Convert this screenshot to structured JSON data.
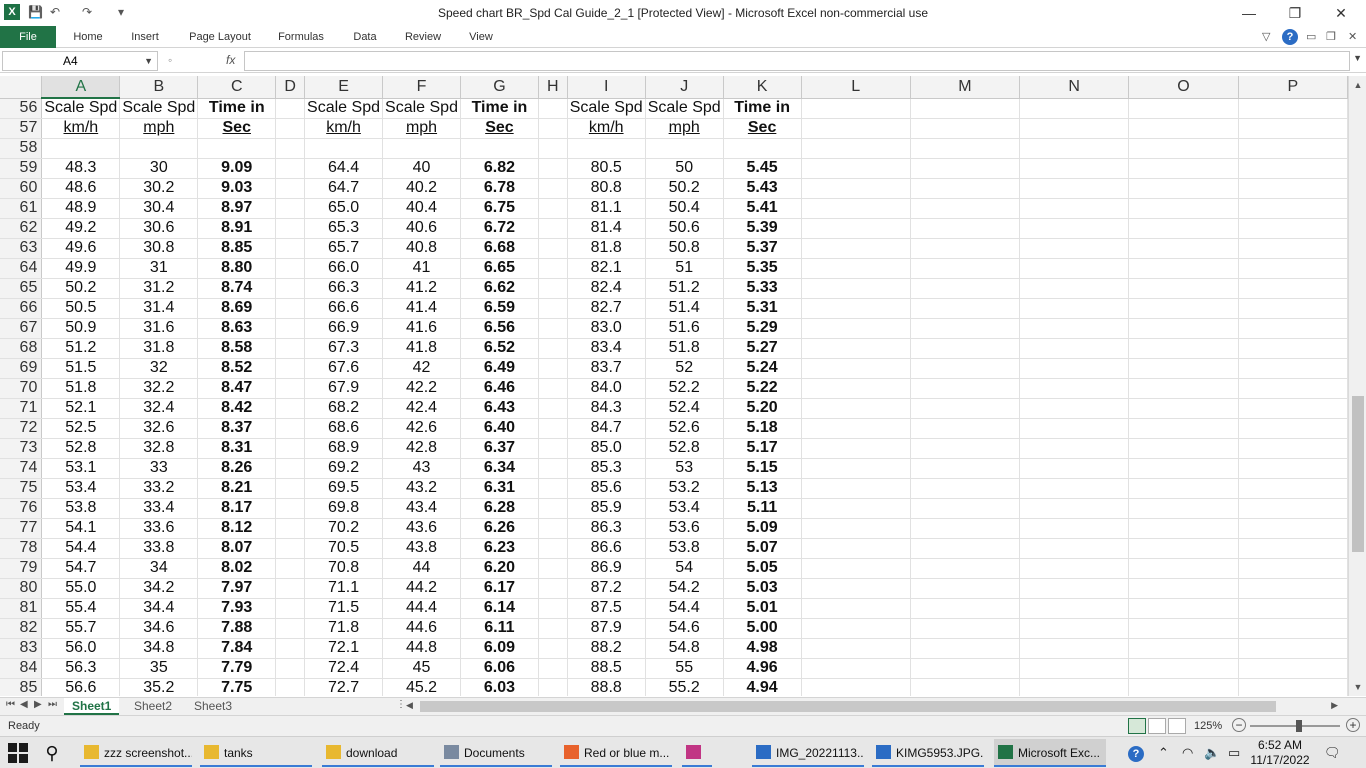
{
  "window": {
    "title": "Speed chart BR_Spd Cal Guide_2_1  [Protected View]  -  Microsoft Excel non-commercial use",
    "app_icon": "X",
    "minimize": "—",
    "restore": "❐",
    "close": "✕"
  },
  "qat": {
    "save": "💾",
    "undo": "↶",
    "redo": "↷",
    "more": "▾"
  },
  "ribbon": {
    "tabs": [
      "File",
      "Home",
      "Insert",
      "Page Layout",
      "Formulas",
      "Data",
      "Review",
      "View"
    ],
    "collapse": "▽",
    "help": "?"
  },
  "formula_bar": {
    "name_box": "A4",
    "fx": "fx",
    "formula": ""
  },
  "columns": [
    "A",
    "B",
    "C",
    "D",
    "E",
    "F",
    "G",
    "H",
    "I",
    "J",
    "K",
    "L",
    "M",
    "N",
    "O",
    "P"
  ],
  "header_rows": [
    {
      "row": "56",
      "cells": [
        "Scale Spd",
        "Scale Spd",
        "Time in",
        "",
        "Scale Spd",
        "Scale Spd",
        "Time in",
        "",
        "Scale Spd",
        "Scale Spd",
        "Time in"
      ]
    },
    {
      "row": "57",
      "cells": [
        "km/h",
        "mph",
        "Sec",
        "",
        "km/h",
        "mph",
        "Sec",
        "",
        "km/h",
        "mph",
        "Sec"
      ]
    },
    {
      "row": "58",
      "cells": [
        "",
        "",
        "",
        "",
        "",
        "",
        "",
        "",
        "",
        "",
        ""
      ]
    }
  ],
  "data_rows": [
    {
      "row": "59",
      "cells": [
        "48.3",
        "30",
        "9.09",
        "",
        "64.4",
        "40",
        "6.82",
        "",
        "80.5",
        "50",
        "5.45"
      ]
    },
    {
      "row": "60",
      "cells": [
        "48.6",
        "30.2",
        "9.03",
        "",
        "64.7",
        "40.2",
        "6.78",
        "",
        "80.8",
        "50.2",
        "5.43"
      ]
    },
    {
      "row": "61",
      "cells": [
        "48.9",
        "30.4",
        "8.97",
        "",
        "65.0",
        "40.4",
        "6.75",
        "",
        "81.1",
        "50.4",
        "5.41"
      ]
    },
    {
      "row": "62",
      "cells": [
        "49.2",
        "30.6",
        "8.91",
        "",
        "65.3",
        "40.6",
        "6.72",
        "",
        "81.4",
        "50.6",
        "5.39"
      ]
    },
    {
      "row": "63",
      "cells": [
        "49.6",
        "30.8",
        "8.85",
        "",
        "65.7",
        "40.8",
        "6.68",
        "",
        "81.8",
        "50.8",
        "5.37"
      ]
    },
    {
      "row": "64",
      "cells": [
        "49.9",
        "31",
        "8.80",
        "",
        "66.0",
        "41",
        "6.65",
        "",
        "82.1",
        "51",
        "5.35"
      ]
    },
    {
      "row": "65",
      "cells": [
        "50.2",
        "31.2",
        "8.74",
        "",
        "66.3",
        "41.2",
        "6.62",
        "",
        "82.4",
        "51.2",
        "5.33"
      ]
    },
    {
      "row": "66",
      "cells": [
        "50.5",
        "31.4",
        "8.69",
        "",
        "66.6",
        "41.4",
        "6.59",
        "",
        "82.7",
        "51.4",
        "5.31"
      ]
    },
    {
      "row": "67",
      "cells": [
        "50.9",
        "31.6",
        "8.63",
        "",
        "66.9",
        "41.6",
        "6.56",
        "",
        "83.0",
        "51.6",
        "5.29"
      ]
    },
    {
      "row": "68",
      "cells": [
        "51.2",
        "31.8",
        "8.58",
        "",
        "67.3",
        "41.8",
        "6.52",
        "",
        "83.4",
        "51.8",
        "5.27"
      ]
    },
    {
      "row": "69",
      "cells": [
        "51.5",
        "32",
        "8.52",
        "",
        "67.6",
        "42",
        "6.49",
        "",
        "83.7",
        "52",
        "5.24"
      ]
    },
    {
      "row": "70",
      "cells": [
        "51.8",
        "32.2",
        "8.47",
        "",
        "67.9",
        "42.2",
        "6.46",
        "",
        "84.0",
        "52.2",
        "5.22"
      ]
    },
    {
      "row": "71",
      "cells": [
        "52.1",
        "32.4",
        "8.42",
        "",
        "68.2",
        "42.4",
        "6.43",
        "",
        "84.3",
        "52.4",
        "5.20"
      ]
    },
    {
      "row": "72",
      "cells": [
        "52.5",
        "32.6",
        "8.37",
        "",
        "68.6",
        "42.6",
        "6.40",
        "",
        "84.7",
        "52.6",
        "5.18"
      ]
    },
    {
      "row": "73",
      "cells": [
        "52.8",
        "32.8",
        "8.31",
        "",
        "68.9",
        "42.8",
        "6.37",
        "",
        "85.0",
        "52.8",
        "5.17"
      ]
    },
    {
      "row": "74",
      "cells": [
        "53.1",
        "33",
        "8.26",
        "",
        "69.2",
        "43",
        "6.34",
        "",
        "85.3",
        "53",
        "5.15"
      ]
    },
    {
      "row": "75",
      "cells": [
        "53.4",
        "33.2",
        "8.21",
        "",
        "69.5",
        "43.2",
        "6.31",
        "",
        "85.6",
        "53.2",
        "5.13"
      ]
    },
    {
      "row": "76",
      "cells": [
        "53.8",
        "33.4",
        "8.17",
        "",
        "69.8",
        "43.4",
        "6.28",
        "",
        "85.9",
        "53.4",
        "5.11"
      ]
    },
    {
      "row": "77",
      "cells": [
        "54.1",
        "33.6",
        "8.12",
        "",
        "70.2",
        "43.6",
        "6.26",
        "",
        "86.3",
        "53.6",
        "5.09"
      ]
    },
    {
      "row": "78",
      "cells": [
        "54.4",
        "33.8",
        "8.07",
        "",
        "70.5",
        "43.8",
        "6.23",
        "",
        "86.6",
        "53.8",
        "5.07"
      ]
    },
    {
      "row": "79",
      "cells": [
        "54.7",
        "34",
        "8.02",
        "",
        "70.8",
        "44",
        "6.20",
        "",
        "86.9",
        "54",
        "5.05"
      ]
    },
    {
      "row": "80",
      "cells": [
        "55.0",
        "34.2",
        "7.97",
        "",
        "71.1",
        "44.2",
        "6.17",
        "",
        "87.2",
        "54.2",
        "5.03"
      ]
    },
    {
      "row": "81",
      "cells": [
        "55.4",
        "34.4",
        "7.93",
        "",
        "71.5",
        "44.4",
        "6.14",
        "",
        "87.5",
        "54.4",
        "5.01"
      ]
    },
    {
      "row": "82",
      "cells": [
        "55.7",
        "34.6",
        "7.88",
        "",
        "71.8",
        "44.6",
        "6.11",
        "",
        "87.9",
        "54.6",
        "5.00"
      ]
    },
    {
      "row": "83",
      "cells": [
        "56.0",
        "34.8",
        "7.84",
        "",
        "72.1",
        "44.8",
        "6.09",
        "",
        "88.2",
        "54.8",
        "4.98"
      ]
    },
    {
      "row": "84",
      "cells": [
        "56.3",
        "35",
        "7.79",
        "",
        "72.4",
        "45",
        "6.06",
        "",
        "88.5",
        "55",
        "4.96"
      ]
    },
    {
      "row": "85",
      "cells": [
        "56.6",
        "35.2",
        "7.75",
        "",
        "72.7",
        "45.2",
        "6.03",
        "",
        "88.8",
        "55.2",
        "4.94"
      ]
    }
  ],
  "sheet_tabs": [
    "Sheet1",
    "Sheet2",
    "Sheet3"
  ],
  "active_sheet": "Sheet1",
  "status": {
    "ready": "Ready",
    "zoom": "125%",
    "zoom_level": 1.25
  },
  "taskbar": {
    "items": [
      {
        "label": "zzz screenshot...",
        "icon": "folder-icon"
      },
      {
        "label": "tanks",
        "icon": "folder-icon"
      },
      {
        "label": "download",
        "icon": "folder-icon"
      },
      {
        "label": "Documents",
        "icon": "document-icon"
      },
      {
        "label": "Red or blue m...",
        "icon": "firefox-icon"
      },
      {
        "label": "",
        "icon": "instagram-icon"
      },
      {
        "label": "IMG_20221113...",
        "icon": "image-icon"
      },
      {
        "label": "KIMG5953.JPG...",
        "icon": "image-icon"
      },
      {
        "label": "Microsoft Exc...",
        "icon": "excel-icon"
      }
    ],
    "time": "6:52 AM",
    "date": "11/17/2022"
  },
  "colors": {
    "excel_green": "#217346",
    "taskbar_accent": "#3a7bd5"
  }
}
